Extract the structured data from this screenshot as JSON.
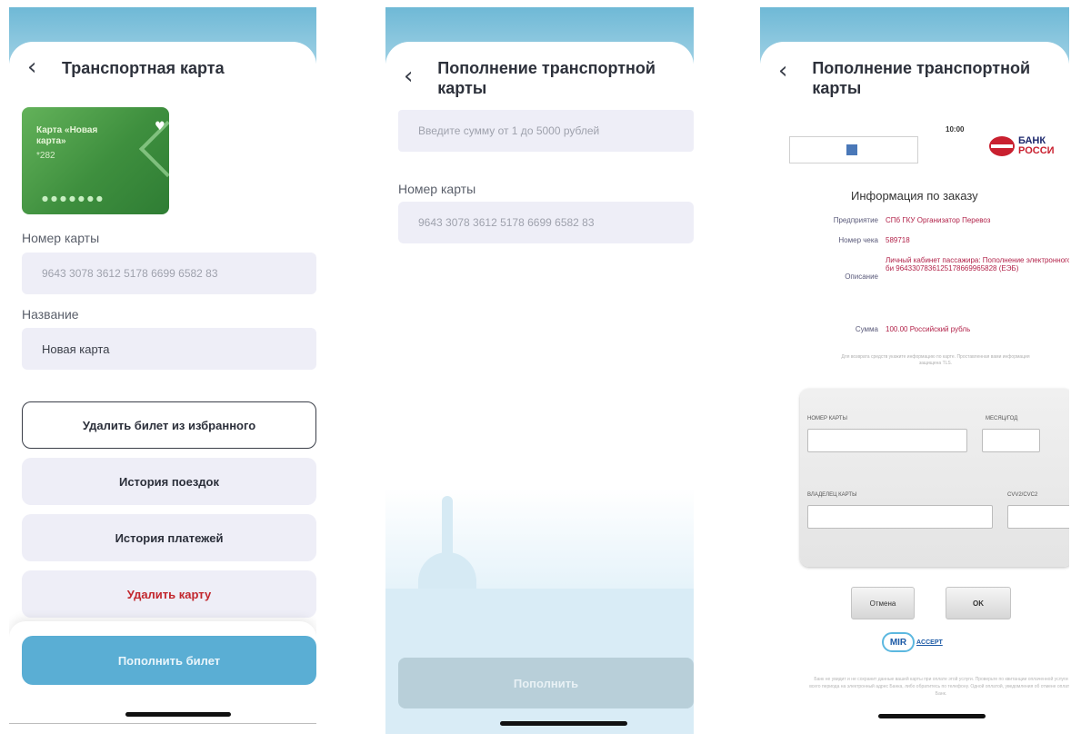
{
  "screen1": {
    "title": "Транспортная карта",
    "card": {
      "name": "Карта «Новая карта»",
      "number": "*282"
    },
    "card_number_label": "Номер карты",
    "card_number_value": "9643 3078 3612 5178 6699 6582 83",
    "name_label": "Название",
    "name_value": "Новая карта",
    "actions": [
      {
        "label": "Удалить билет из избранного"
      },
      {
        "label": "История поездок"
      },
      {
        "label": "История платежей"
      },
      {
        "label": "Удалить карту"
      }
    ],
    "topup_button": "Пополнить билет"
  },
  "screen2": {
    "title": "Пополнение транспортной карты",
    "amount_placeholder": "Введите сумму от 1 до 5000 рублей",
    "card_number_label": "Номер карты",
    "card_number_value": "9643 3078 3612 5178 6699 6582 83",
    "submit_button": "Пополнить"
  },
  "screen3": {
    "title": "Пополнение транспортной карты",
    "time": "10:00",
    "bank_logo_text": [
      "БАНК",
      "РОССИ"
    ],
    "info_title": "Информация по заказу",
    "rows": [
      {
        "key": "Предприятие",
        "value": "СПб ГКУ Организатор Перевоз"
      },
      {
        "key": "Номер чека",
        "value": "589718"
      },
      {
        "key": "Описание",
        "value": "Личный кабинет пассажира: Пополнение электронного би 9643307836125178669965828 (ЕЭБ)"
      },
      {
        "key": "Сумма",
        "value": "100.00 Российский рубль"
      }
    ],
    "note": "Для возврата средств укажите информацию по карте. Проставленная вами информация защищена TLS.",
    "form": {
      "card_number_label": "НОМЕР КАРТЫ",
      "expiry_label": "МЕСЯЦ/ГОД",
      "holder_label": "ВЛАДЕЛЕЦ КАРТЫ",
      "cvv_label": "CVV2/CVC2"
    },
    "cancel_button": "Отмена",
    "ok_button": "OK",
    "mir_logo": [
      "MIR",
      "ACCEPT"
    ],
    "fine_print": "Банк не увидит и не сохранит данные вашей карты при оплате этой услуги. Проверьте по квитанции оплаченной услуги всего периода на электронный адрес Банка, либо обратитесь по телефону. Одной оплатой, уведомления об отмене оплаты Банк."
  }
}
